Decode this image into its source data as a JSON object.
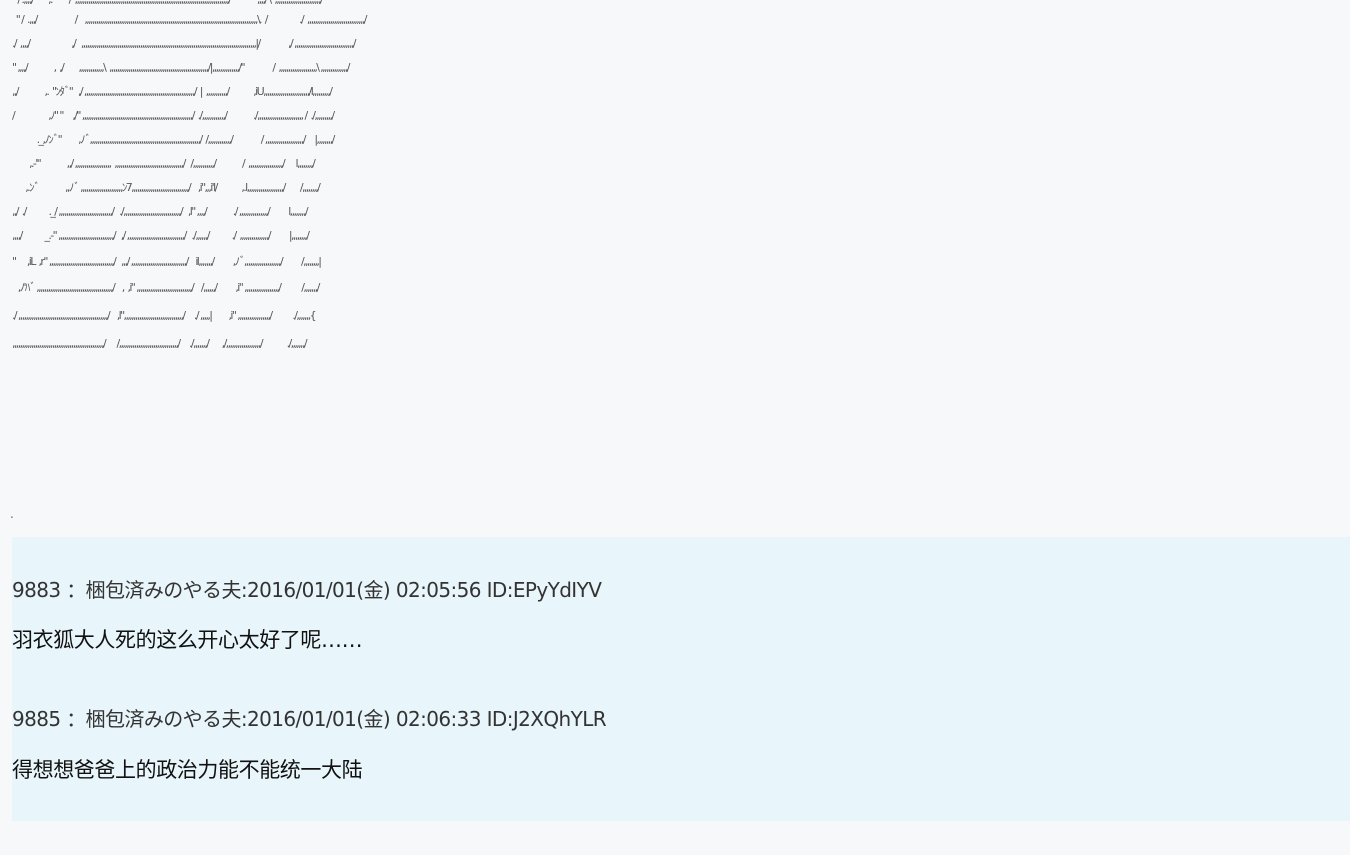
{
  "ascii_art": [
    "\" / .,,,,/        ,. \"      /  ,,,,,,,,,,,,,,,,,,,,,,,,,,,,,,,,,,,,,,,,,,,,,,,,,,,,,,,,,,,,,,,,,,,,,,,,,,,,,,,,,/              ,,,,/ \\  ,,,,,,,,,,,,,,,,,,,,,,,,/",
    "  \" /  .,,,/                    /    ,,,,,,,,,,,,,,,,,,,,,,,,,,,,,,,,,,,,,,,,,,,,,,,,,,,,,,,,,,,,,,,,,,,,,,,,,,,,,,,,,,,,,,,,,,,\\.  /                 ./  ,,,,,,,,,,,,,,,,,,,,,,,,,,,,,,/",
    "./  ,,,,/                      ,/   ,,,,,,,,,,,,,,,,,,,,,,,,,,,,,,,,,,,,,,,,,,,,,,,,,,,,,,,,,,,,,,,,,,,,,,,,,,,,,,,,,,,,,,,,,,,,|/               ,/ ,,,,,,,,,,,,,,,,,,,,,,,,,,,,,,,/",
    "\" ,,,,/              ,  ,/        ,,,,,,,,,,,,,\\  ,,,,,,,,,,,,,,,,,,,,,,,,,,,,,,,,,,,,,,,,,,,,,,,,,,,,/|,,,,,,,,,,,,,,/\"               /  ,,,,,,,,,,,,,,,,,,,,\\ ,,,,,,,,,,,,,,/",
    ",,/              ,.  \"ﾝﾀﾞ\"   ,/ ,,,,,,,,,,,,,,,,,,,,,,,,,,,,,,,,,,,,,,,,,,,,,,,,,,,,,,,,,,/  |  ,,,,,,,,,,,/             ,iU,,,,,,,,,,,,,,,,,,,,,,,,/l,,,,,,,,,/",
    "/                  ,ﾉ\" \"     ,/\" ,,,,,,,,,,,,,,,,,,,,,,,,,,,,,,,,,,,,,,,,,,,,,,,,,,,,,,,,,,/  ./,,,,,,,,,,,,/              ./,,,,,,,,,,,,,,,,,,,,,,,, /  ./,,,,,,,,,/",
    "             ._,ﾉﾝﾞ\"         ,ﾉﾞ,,,,,,,,,,,,,,,,,,,,,,,,,,,,,,,,,,,,,,,,,,,,,,,,,,,,,,,,,,/  /,,,,,,,,,,,,/               / ,,,,,,,,,,,,,,,,,,,,/     |,,,,,,,,/",
    "         ,.-'\"              ,,/ ,,,,,,,,,,,,,,,,,,,  ,,,,,,,,,,,,,,,,,,,,,,,,,,,,,,,,,,,,/   /,,,,,,,,,,,/              /  ,,,,,,,,,,,,,,,,,,/      l,,,,,,,,/",
    "       ,.ﾝﾞ              ,,ﾉﾞ ,,,,,,,,,,,,,,,,,,,,,,ﾝ7,,,,,,,,,,,,,,,,,,,,,,,,,,,,,,/    ,i\",,,i'l/             ,.l,,,,,,,,,,,,,,,,,,,/        /,,,,,,,,/",
    ",,/  ./            ._/ ,,,,,,,,,,,,,,,,,,,,,,,,,,,,/   ./,,,,,,,,,,,,,,,,,,,,,,,,,,,,,,/   ,l\" ,,,,/              ./ ,,,,,,,,,,,,,,,/          l,,,,,,,,/",
    ",,,,/            _.-\" ,,,,,,,,,,,,,,,,,,,,,,,,,,,,,/   ,/ ,,,,,,,,,,,,,,,,,,,,,,,,,,,,,,/   ./,,,,,,/            ./  ,,,,,,,,,,,,,,,/          |,,,,,,,,/",
    "\"      ,iL  ,r\" ,,,,,,,,,,,,,,,,,,,,,,,,,,,,,,,,,,/   ,,,/ ,,,,,,,,,,,,,,,,,,,,,,,,,,,,,/    il,,,,,,,/          ,ﾉﾞ,,,,,,,,,,,,,,,,,,,/          /,,,,,,,,|",
    "   ,ﾉ'ﾊﾞ ,,,,,,,,,,,,,,,,,,,,,,,,,,,,,,,,,,,,,,,,/    ,  ,i\" ,,,,,,,,,,,,,,,,,,,,,,,,,,,,,/    /,,,,,,/          ,i\" ,,,,,,,,,,,,,,,,,,/           /,,,,,,,/",
    "./ ,,,,,,,,,,,,,,,,,,,,,,,,,,,,,,,,,,,,,,,,,,,,,,,/    ,l\",,,,,,,,,,,,,,,,,,,,,,,,,,,,,,,/     ./ ,,,,,|         ,i\" ,,,,,,,,,,,,,,,,,/           ./,,,,,,,{",
    ",,,,,,,,,,,,,,,,,,,,,,,,,,,,,,,,,,,,,,,,,,,,,,,,/      /,,,,,,,,,,,,,,,,,,,,,,,,,,,,,,,/     ./,,,,,,,/       ,/,,,,,,,,,,,,,,,,,,/             ./,,,,,,,/"
  ],
  "separator_dot": ".",
  "posts": [
    {
      "header": "9883 ：梱包済みのやる夫:2016/01/01(金) 02:05:56 ID:EPyYdIYV",
      "body": "羽衣狐大人死的这么开心太好了呢……"
    },
    {
      "header": "9885 ：梱包済みのやる夫:2016/01/01(金) 02:06:33 ID:J2XQhYLR",
      "body": "得想想爸爸上的政治力能不能统一大陆"
    }
  ],
  "colors": {
    "page_background": "#f7f8fa",
    "post_block_background": "#e8f5fa"
  }
}
